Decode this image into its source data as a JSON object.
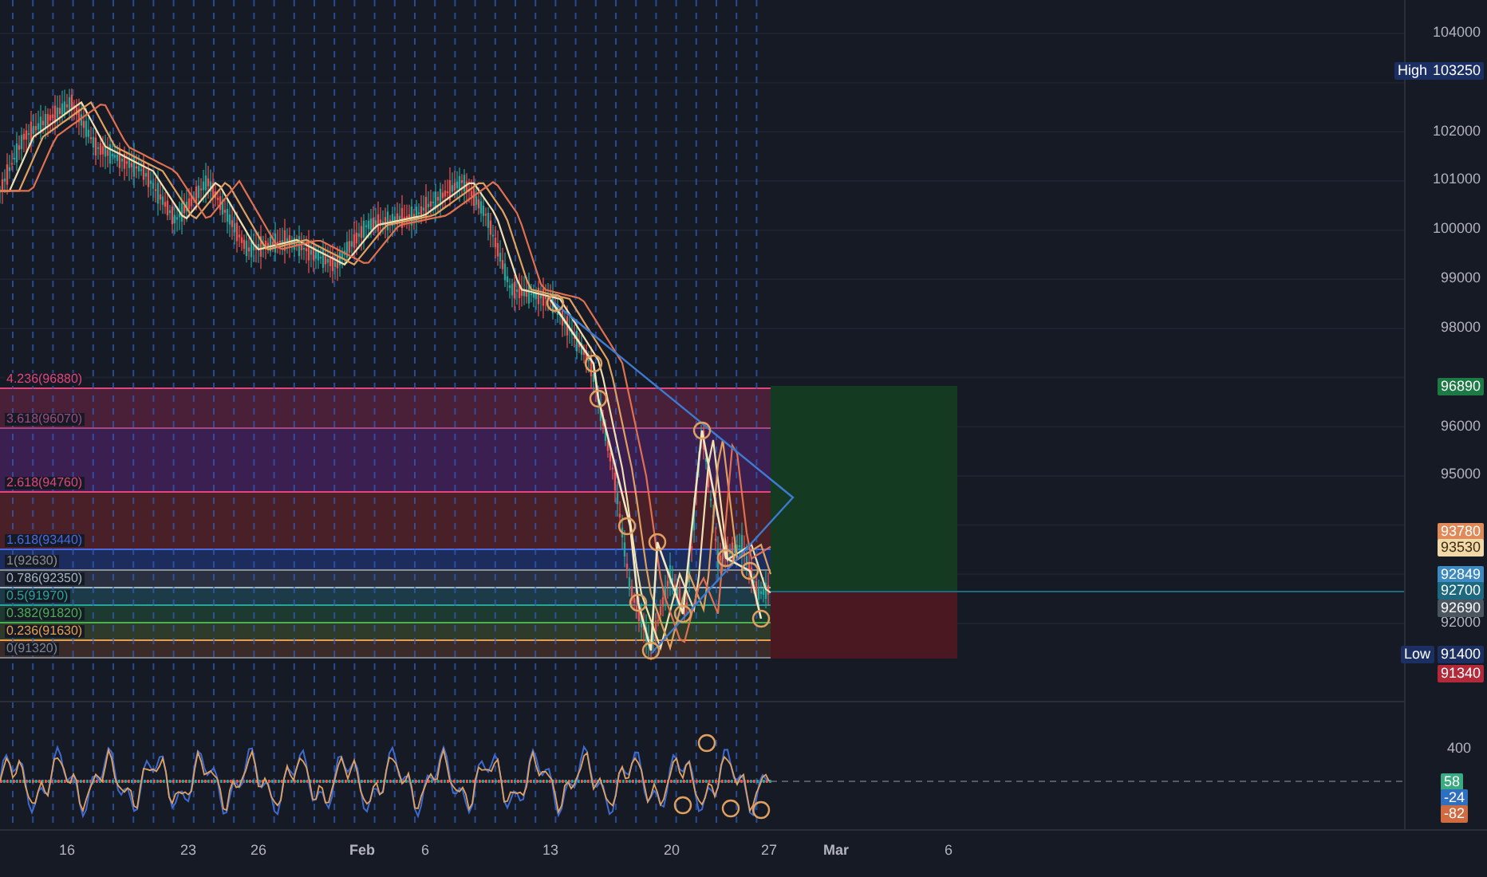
{
  "fib_levels": [
    {
      "label": "4.236(96880)",
      "color": "#e0457b"
    },
    {
      "label": "3.618(96070)",
      "color": "#a04a80"
    },
    {
      "label": "2.618(94760)",
      "color": "#e0457b"
    },
    {
      "label": "1.618(93440)",
      "color": "#4a6be0"
    },
    {
      "label": "1(92630)",
      "color": "#8a8f99"
    },
    {
      "label": "0.786(92350)",
      "color": "#a0b4c0"
    },
    {
      "label": "0.5(91970)",
      "color": "#26a69a"
    },
    {
      "label": "0.382(91820)",
      "color": "#4caf50"
    },
    {
      "label": "0.236(91630)",
      "color": "#e8a050"
    },
    {
      "label": "0(91320)",
      "color": "#80838c"
    }
  ],
  "price_axis": [
    "104000",
    "102000",
    "101000",
    "100000",
    "99000",
    "98000",
    "96000",
    "95000",
    "92000"
  ],
  "high": {
    "label": "High",
    "value": "103250"
  },
  "low": {
    "label": "Low",
    "value": "91400"
  },
  "price_tags": [
    {
      "text": "96890",
      "color": "#1e7a45"
    },
    {
      "text": "93780",
      "color": "#e08a5a"
    },
    {
      "text": "93530",
      "color": "#f0d8a8"
    },
    {
      "text": "92849",
      "color": "#3d8ac0"
    },
    {
      "text": "92700",
      "color": "#1d6a80"
    },
    {
      "text": "92690",
      "color": "#4a5560"
    },
    {
      "text": "91340",
      "color": "#b22a3a"
    }
  ],
  "oscillator": {
    "axis_label": "400",
    "tags": [
      {
        "text": "58",
        "color": "#3aaa80"
      },
      {
        "text": "-24",
        "color": "#2f6fc0"
      },
      {
        "text": "-82",
        "color": "#d06a40"
      }
    ]
  },
  "time_axis": [
    {
      "label": "16",
      "bold": false
    },
    {
      "label": "23",
      "bold": false
    },
    {
      "label": "26",
      "bold": false
    },
    {
      "label": "Feb",
      "bold": true
    },
    {
      "label": "6",
      "bold": false
    },
    {
      "label": "13",
      "bold": false
    },
    {
      "label": "20",
      "bold": false
    },
    {
      "label": "27",
      "bold": false
    },
    {
      "label": "Mar",
      "bold": true
    },
    {
      "label": "6",
      "bold": false
    }
  ]
}
